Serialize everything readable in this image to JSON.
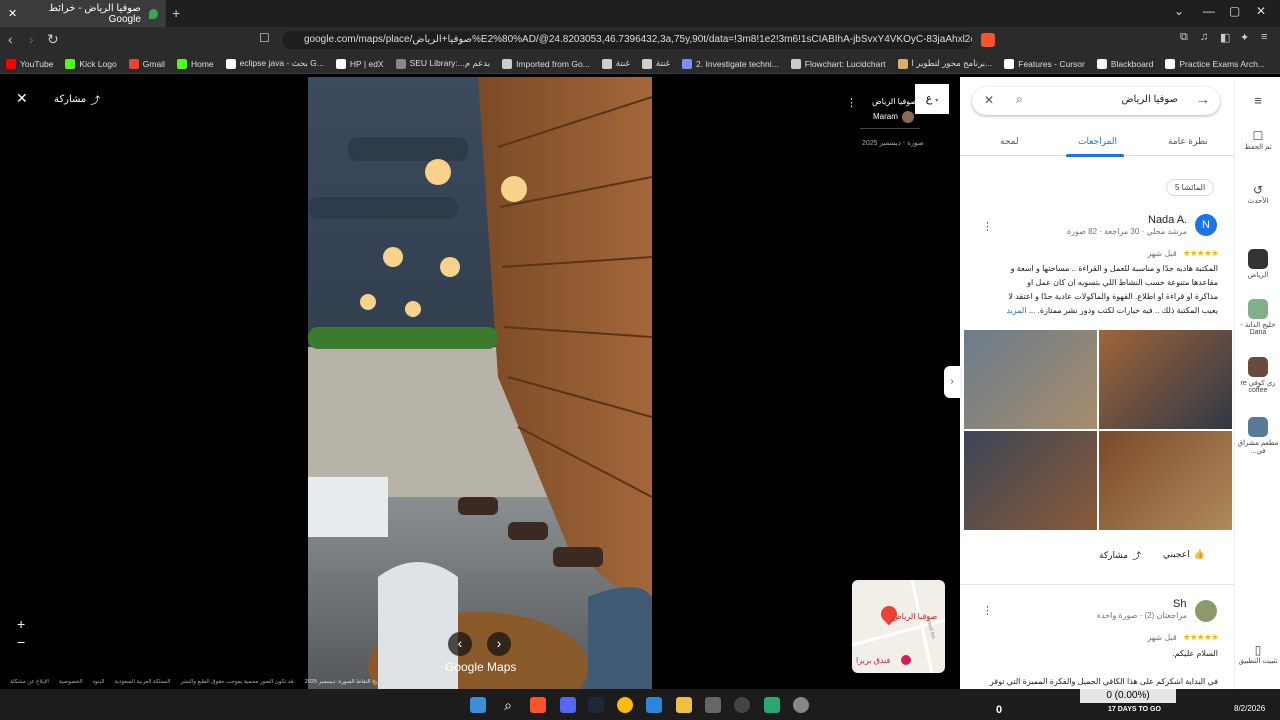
{
  "browser": {
    "tab_title": "صوفيا الرياض - خرائط Google",
    "tab_close": "✕",
    "new_tab": "+",
    "url": "google.com/maps/place/صوفيا+الرياض%E2%80%AD/@24.8203053,46.7396432,3a,75y,90t/data=!3m8!1e2!3m6!1sCIABIhA-jbSvxY4VKOyC-83jaAhxl2e10!...",
    "bookmarks": [
      {
        "label": "YouTube",
        "color": "#ff0000"
      },
      {
        "label": "Kick Logo",
        "color": "#53fc18"
      },
      {
        "label": "Gmail",
        "color": "#ea4335"
      },
      {
        "label": "Home",
        "color": "#53fc18"
      },
      {
        "label": "eclipse java - بحث G...",
        "color": "#ffffff"
      },
      {
        "label": "HP | edX",
        "color": "#ffffff"
      },
      {
        "label": "SEU Library:...بدعم م",
        "color": "#888888"
      },
      {
        "label": "Imported from Go...",
        "color": "#cccccc"
      },
      {
        "label": "غنتة",
        "color": "#cccccc"
      },
      {
        "label": "غنتة",
        "color": "#cccccc"
      },
      {
        "label": "2. Investigate techni...",
        "color": "#7b8cff"
      },
      {
        "label": "Flowchart: Lucidchart",
        "color": "#cccccc"
      },
      {
        "label": "برنامج محور لتطوير ا...",
        "color": "#d4b06a"
      },
      {
        "label": "Features - Cursor",
        "color": "#ffffff"
      },
      {
        "label": "Blackboard",
        "color": "#ffffff"
      },
      {
        "label": "Practice Exams Arch...",
        "color": "#ffffff"
      }
    ]
  },
  "viewer": {
    "close": "✕",
    "share_label": "مشاركة",
    "place_name": "صوفيا الرياض",
    "author": "Maram",
    "author_initial": "ع",
    "photo_date": "صورة - ديسمبر 2025",
    "capture_date": "تاريخ التقاط الصورة: ديسمبر 2025",
    "google_maps": "Google Maps",
    "zoom_in": "+",
    "zoom_out": "−",
    "prev": "‹",
    "next": "›",
    "footer_links": [
      "الإبلاغ عن مشكلة",
      "الخصوصية",
      "البنود",
      "المملكة العربية السعودية",
      "قد تكون الصور محمية بموجب حقوق الطبع والنشر."
    ],
    "minimap_label": "صوفيا الرياض",
    "minimap_hotel": "فندق بريرا",
    "minimap_street": "Ahmad Ibn"
  },
  "panel": {
    "search_value": "صوفيا الرياض",
    "tabs": [
      "نظرة عامة",
      "المراجعات",
      "لمحة"
    ],
    "active_tab": "المراجعات",
    "filter_chip": "المائشا 5",
    "reviews": [
      {
        "name": "Nada A.",
        "initial": "N",
        "meta": "مرشد محلي · 30 مراجعة · 82 صورة",
        "stars": "★★★★★",
        "time": "قبل شهر",
        "text": "المكتبة هاديه جدًا و مناسبة للعمل و القراءة .. مساحتها و اسعة و مقاعدها متنوعة حسب النشاط اللي بتسويه ان كان عمل او مذاكرة او قراءة او اطلاع. القهوة والماكولات عادية جدًا و اعتقد لا يعيب المكتبة ذلك .. فيه خيارات لكتب ودور نشر ممتازة. ...",
        "more": "المزيد",
        "like": "اعجبني",
        "share": "مشاركة"
      },
      {
        "name": "Sh",
        "meta": "مراجعتان (2) · صورة واحدة",
        "stars": "★★★★★",
        "time": "قبل شهر",
        "text1": "السلام عليكم.",
        "text2": "في البداية اشكركم على هذا الكافي الجميل والفكرة المميزة التي توفر"
      }
    ]
  },
  "rail": {
    "items": [
      "تم الحفظ",
      "الأحدث",
      "الرياض",
      "خليج الدانة - Dana",
      "ري كوفي re coffee",
      "مطعم مشراق في...",
      "تثبيت التطبيق"
    ]
  },
  "taskbar": {
    "indicator": "0 (0.00%)",
    "zero": "0",
    "days": "17 DAYS TO GO",
    "date": "8/2/2026"
  }
}
